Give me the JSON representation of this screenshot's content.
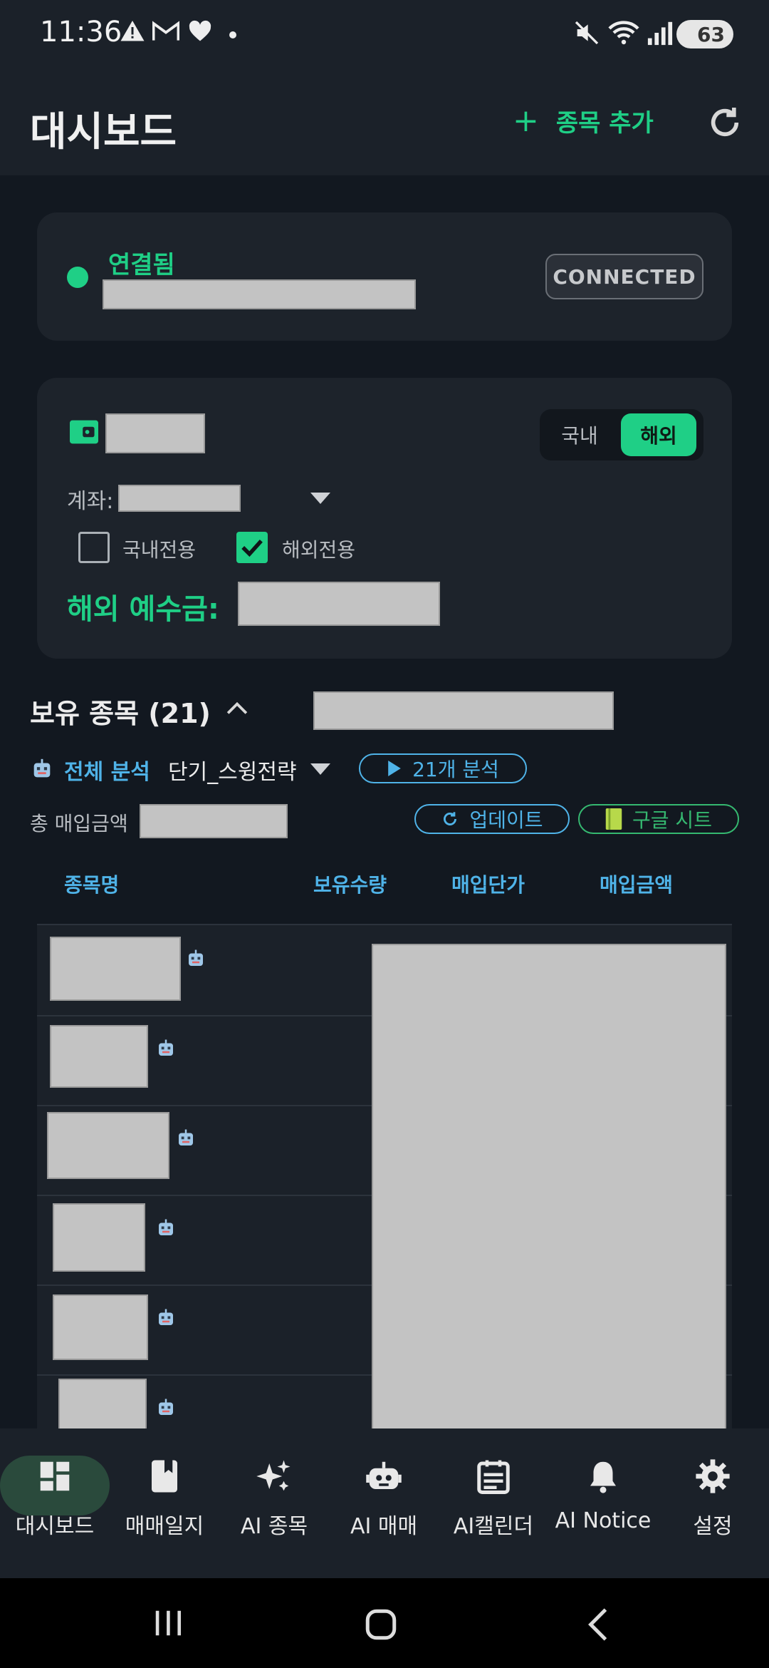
{
  "status_bar": {
    "time": "11:36",
    "battery": "63"
  },
  "app_bar": {
    "title": "대시보드",
    "add_label": "종목 추가"
  },
  "connection": {
    "status_label": "연결됨",
    "badge": "CONNECTED"
  },
  "account": {
    "segment": [
      "국내",
      "해외"
    ],
    "selected_segment": "해외",
    "account_label": "계좌:",
    "checkbox_domestic": "국내전용",
    "checkbox_overseas": "해외전용",
    "deposit_label": "해외 예수금:"
  },
  "holdings": {
    "title": "보유 종목 (21)",
    "analyze_all": "전체 분석",
    "strategy": "단기_스윙전략",
    "analyze_button": "21개 분석",
    "total_label": "총 매입금액",
    "update_button": "업데이트",
    "sheet_button": "구글 시트",
    "columns": [
      "종목명",
      "보유수량",
      "매입단가",
      "매입금액"
    ]
  },
  "bottom_nav": [
    "대시보드",
    "매매일지",
    "AI 종목",
    "AI 매매",
    "AI캘린더",
    "AI Notice",
    "설정"
  ],
  "colors": {
    "accent": "#1fcf86",
    "link": "#4fb3e8",
    "background": "#121820",
    "card": "#1d232b"
  }
}
